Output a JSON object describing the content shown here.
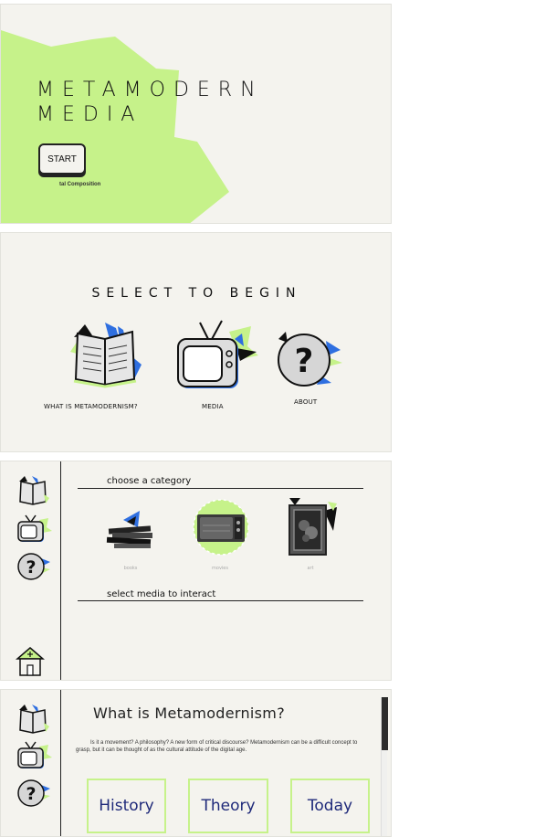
{
  "screen1": {
    "title_line1": "METAMODERN",
    "title_line2": "MEDIA",
    "start_label": "START",
    "caption": "tal Composition"
  },
  "screen2": {
    "title": "SELECT TO BEGIN",
    "options": [
      {
        "label": "WHAT IS METAMODERNISM?",
        "icon": "book-icon"
      },
      {
        "label": "MEDIA",
        "icon": "tv-icon"
      },
      {
        "label": "ABOUT",
        "icon": "question-icon"
      }
    ]
  },
  "screen3": {
    "heading_category": "choose a category",
    "categories": [
      {
        "label": "books",
        "icon": "books-stack-icon"
      },
      {
        "label": "movies",
        "icon": "tv-circle-icon"
      },
      {
        "label": "art",
        "icon": "picture-frame-icon"
      }
    ],
    "heading_media": "select media to interact"
  },
  "screen4": {
    "title": "What is Metamodernism?",
    "description": "Is it a movement? A philosophy? A new form of critical discourse? Metamodernism can be a difficult concept to grasp, but it can be thought of as the cultural attitude of the digital age.",
    "buttons": [
      "History",
      "Theory",
      "Today"
    ]
  },
  "colors": {
    "accent_lime": "#c6f28a",
    "background": "#f4f3ee",
    "blue_accent": "#2f6fe0",
    "button_text": "#1f2a7a"
  }
}
